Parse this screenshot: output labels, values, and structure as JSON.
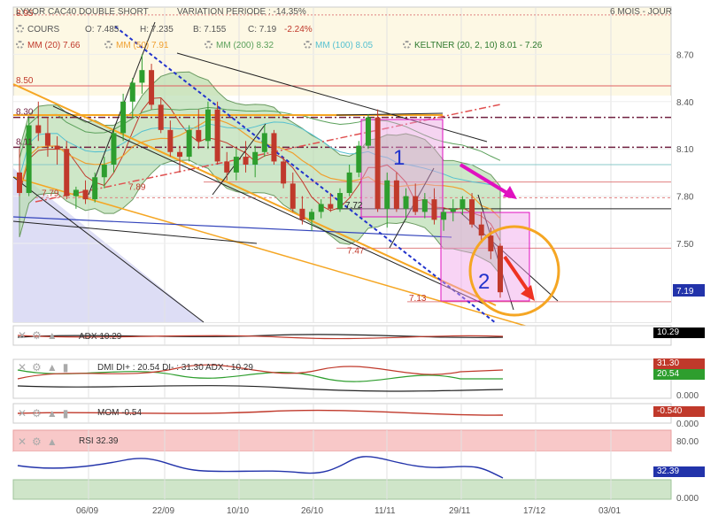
{
  "header": {
    "title": "LYXOR CAC40 DOUBLE SHORT",
    "variation": "VARIATION PERIODE : -14.35%",
    "period": "6 MOIS - JOUR"
  },
  "legend": {
    "cours": "COURS",
    "o": "O: 7.485",
    "h": "H: 7.235",
    "b": "B: 7.155",
    "c": "C: 7.19",
    "chg": "-2.24%",
    "mm20": "MM (20) 7.66",
    "mm50": "MM (50) 7.91",
    "mm200": "MM (200) 8.32",
    "mm100": "MM (100) 8.05",
    "keltner": "KELTNER (20, 2, 10) 8.01 - 7.26"
  },
  "colors": {
    "up": "#2e9e2e",
    "down": "#c0392b",
    "keltner_fill": "#b9ddb0",
    "mm20": "#c0392b",
    "mm50": "#f0a030",
    "mm200": "#5aa05a",
    "mm100": "#55c0d0",
    "magenta": "#e010c0",
    "orange": "#f5a623",
    "blue_dash": "#2233cc"
  },
  "chart_data": [
    {
      "type": "candlestick",
      "title": "LYXOR CAC40 DOUBLE SHORT",
      "yticks": [
        7.5,
        7.8,
        8.1,
        8.4,
        8.7
      ],
      "ytick_labels": [
        "7.50",
        "7.80",
        "8.10",
        "8.40",
        "8.70"
      ],
      "ylim": [
        7.0,
        9.0
      ],
      "xtick_labels": [
        "06/09",
        "22/09",
        "10/10",
        "26/10",
        "11/11",
        "29/11",
        "17/12",
        "03/01"
      ],
      "level_labels": [
        "8.95",
        "8.50",
        "8.30",
        "8.11",
        "7.89",
        "7.79",
        "7.72",
        "7.47",
        "7.13"
      ],
      "last_price": "7.19",
      "annotations": [
        "1",
        "2"
      ],
      "candles": [
        {
          "o": 7.95,
          "h": 8.1,
          "l": 7.8,
          "c": 7.82
        },
        {
          "o": 7.82,
          "h": 8.3,
          "l": 7.8,
          "c": 8.25
        },
        {
          "o": 8.25,
          "h": 8.4,
          "l": 8.15,
          "c": 8.2
        },
        {
          "o": 8.2,
          "h": 8.3,
          "l": 8.05,
          "c": 8.12
        },
        {
          "o": 8.12,
          "h": 8.18,
          "l": 8.0,
          "c": 8.1
        },
        {
          "o": 8.1,
          "h": 8.15,
          "l": 7.78,
          "c": 7.8
        },
        {
          "o": 7.8,
          "h": 7.86,
          "l": 7.72,
          "c": 7.84
        },
        {
          "o": 7.84,
          "h": 7.9,
          "l": 7.75,
          "c": 7.78
        },
        {
          "o": 7.78,
          "h": 7.95,
          "l": 7.76,
          "c": 7.92
        },
        {
          "o": 7.92,
          "h": 8.05,
          "l": 7.85,
          "c": 8.0
        },
        {
          "o": 8.0,
          "h": 8.22,
          "l": 7.95,
          "c": 8.2
        },
        {
          "o": 8.2,
          "h": 8.45,
          "l": 8.15,
          "c": 8.4
        },
        {
          "o": 8.4,
          "h": 8.55,
          "l": 8.3,
          "c": 8.52
        },
        {
          "o": 8.52,
          "h": 8.7,
          "l": 8.45,
          "c": 8.6
        },
        {
          "o": 8.6,
          "h": 8.64,
          "l": 8.35,
          "c": 8.38
        },
        {
          "o": 8.38,
          "h": 8.42,
          "l": 8.2,
          "c": 8.22
        },
        {
          "o": 8.22,
          "h": 8.28,
          "l": 8.05,
          "c": 8.08
        },
        {
          "o": 8.08,
          "h": 8.12,
          "l": 7.95,
          "c": 8.05
        },
        {
          "o": 8.05,
          "h": 8.25,
          "l": 8.02,
          "c": 8.22
        },
        {
          "o": 8.22,
          "h": 8.35,
          "l": 8.1,
          "c": 8.15
        },
        {
          "o": 8.15,
          "h": 8.4,
          "l": 8.1,
          "c": 8.35
        },
        {
          "o": 8.35,
          "h": 8.4,
          "l": 8.0,
          "c": 8.02
        },
        {
          "o": 8.02,
          "h": 8.08,
          "l": 7.9,
          "c": 7.95
        },
        {
          "o": 7.95,
          "h": 8.1,
          "l": 7.9,
          "c": 8.05
        },
        {
          "o": 8.05,
          "h": 8.15,
          "l": 7.95,
          "c": 8.0
        },
        {
          "o": 8.0,
          "h": 8.12,
          "l": 7.92,
          "c": 8.08
        },
        {
          "o": 8.08,
          "h": 8.25,
          "l": 8.05,
          "c": 8.2
        },
        {
          "o": 8.2,
          "h": 8.22,
          "l": 8.0,
          "c": 8.02
        },
        {
          "o": 8.02,
          "h": 8.05,
          "l": 7.85,
          "c": 7.88
        },
        {
          "o": 7.88,
          "h": 7.95,
          "l": 7.7,
          "c": 7.72
        },
        {
          "o": 7.72,
          "h": 7.8,
          "l": 7.62,
          "c": 7.65
        },
        {
          "o": 7.65,
          "h": 7.72,
          "l": 7.58,
          "c": 7.7
        },
        {
          "o": 7.7,
          "h": 7.78,
          "l": 7.66,
          "c": 7.75
        },
        {
          "o": 7.75,
          "h": 7.82,
          "l": 7.7,
          "c": 7.72
        },
        {
          "o": 7.72,
          "h": 7.85,
          "l": 7.7,
          "c": 7.82
        },
        {
          "o": 7.82,
          "h": 8.0,
          "l": 7.8,
          "c": 7.95
        },
        {
          "o": 7.95,
          "h": 8.15,
          "l": 7.92,
          "c": 8.12
        },
        {
          "o": 8.12,
          "h": 8.32,
          "l": 8.1,
          "c": 8.3
        },
        {
          "o": 8.3,
          "h": 8.35,
          "l": 7.7,
          "c": 7.72
        },
        {
          "o": 7.72,
          "h": 7.95,
          "l": 7.6,
          "c": 7.9
        },
        {
          "o": 7.9,
          "h": 7.95,
          "l": 7.7,
          "c": 7.72
        },
        {
          "o": 7.72,
          "h": 7.85,
          "l": 7.65,
          "c": 7.8
        },
        {
          "o": 7.8,
          "h": 7.88,
          "l": 7.68,
          "c": 7.7
        },
        {
          "o": 7.7,
          "h": 7.82,
          "l": 7.66,
          "c": 7.78
        },
        {
          "o": 7.78,
          "h": 7.85,
          "l": 7.62,
          "c": 7.65
        },
        {
          "o": 7.65,
          "h": 7.72,
          "l": 7.58,
          "c": 7.7
        },
        {
          "o": 7.7,
          "h": 7.78,
          "l": 7.64,
          "c": 7.72
        },
        {
          "o": 7.72,
          "h": 7.8,
          "l": 7.68,
          "c": 7.78
        },
        {
          "o": 7.78,
          "h": 7.82,
          "l": 7.6,
          "c": 7.62
        },
        {
          "o": 7.62,
          "h": 7.7,
          "l": 7.5,
          "c": 7.55
        },
        {
          "o": 7.55,
          "h": 7.6,
          "l": 7.4,
          "c": 7.45
        },
        {
          "o": 7.485,
          "h": 7.5,
          "l": 7.155,
          "c": 7.19
        }
      ]
    },
    {
      "type": "line",
      "title": "ADX",
      "series": [
        {
          "name": "ADX",
          "values": [
            10.29
          ]
        }
      ]
    },
    {
      "type": "line",
      "title": "DMI",
      "series": [
        {
          "name": "DI+",
          "values": [
            20.54
          ]
        },
        {
          "name": "DI-",
          "values": [
            31.3
          ]
        },
        {
          "name": "ADX",
          "values": [
            10.29
          ]
        }
      ]
    },
    {
      "type": "line",
      "title": "MOM",
      "series": [
        {
          "name": "MOM",
          "values": [
            -0.54
          ]
        }
      ]
    },
    {
      "type": "line",
      "title": "RSI",
      "series": [
        {
          "name": "RSI",
          "values": [
            32.39
          ]
        }
      ],
      "yticks": [
        "80.00",
        "0.000"
      ]
    }
  ],
  "panels": {
    "adx_label": "ADX 10.29",
    "adx_value": "10.29",
    "dmi_label": "DMI DI+ : 20.54 DI- : 31.30 ADX : 10.29",
    "dmi_val1": "31.30",
    "dmi_val2": "20.54",
    "dmi_zero": "0.000",
    "mom_label": "MOM -0.54",
    "mom_value": "-0.540",
    "mom_zero": "0.000",
    "rsi_label": "RSI 32.39",
    "rsi_value": "32.39",
    "rsi_top": "80.00",
    "rsi_zero": "0.000"
  }
}
